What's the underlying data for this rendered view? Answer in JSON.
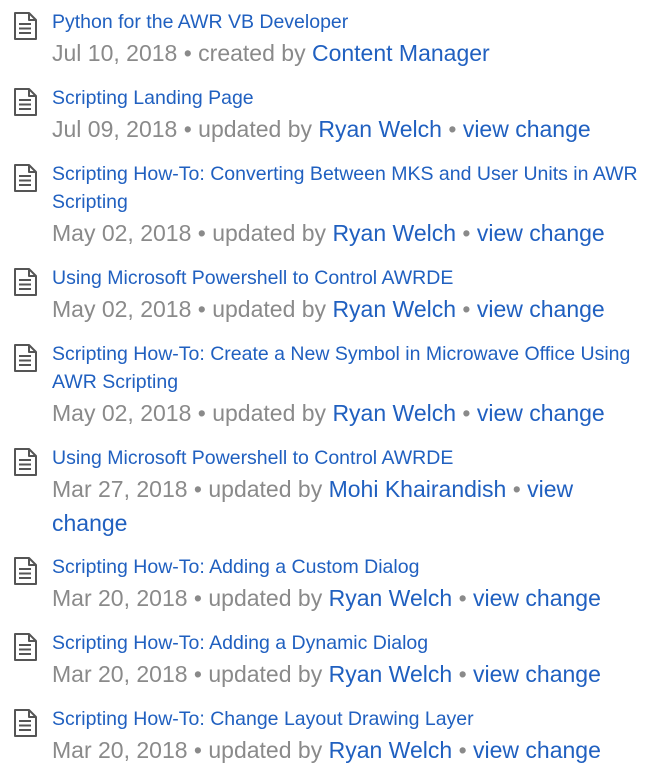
{
  "separator": "•",
  "items": [
    {
      "title": "Python for the AWR VB Developer",
      "date": "Jul 10, 2018",
      "action": "created by",
      "user": "Content Manager",
      "view_change": ""
    },
    {
      "title": "Scripting Landing Page",
      "date": "Jul 09, 2018",
      "action": "updated by",
      "user": "Ryan Welch",
      "view_change": "view change"
    },
    {
      "title": "Scripting How-To: Converting Between MKS and User Units in AWR Scripting",
      "date": "May 02, 2018",
      "action": "updated by",
      "user": "Ryan Welch",
      "view_change": "view change"
    },
    {
      "title": "Using Microsoft Powershell to Control AWRDE",
      "date": "May 02, 2018",
      "action": "updated by",
      "user": "Ryan Welch",
      "view_change": "view change"
    },
    {
      "title": "Scripting How-To: Create a New Symbol in Microwave Office Using AWR Scripting",
      "date": "May 02, 2018",
      "action": "updated by",
      "user": "Ryan Welch",
      "view_change": "view change"
    },
    {
      "title": "Using Microsoft Powershell to Control AWRDE",
      "date": "Mar 27, 2018",
      "action": "updated by",
      "user": "Mohi Khairandish",
      "view_change": "view change"
    },
    {
      "title": "Scripting How-To: Adding a Custom Dialog",
      "date": "Mar 20, 2018",
      "action": "updated by",
      "user": "Ryan Welch",
      "view_change": "view change"
    },
    {
      "title": "Scripting How-To: Adding a Dynamic Dialog",
      "date": "Mar 20, 2018",
      "action": "updated by",
      "user": "Ryan Welch",
      "view_change": "view change"
    },
    {
      "title": "Scripting How-To: Change Layout Drawing Layer",
      "date": "Mar 20, 2018",
      "action": "updated by",
      "user": "Ryan Welch",
      "view_change": "view change"
    }
  ]
}
